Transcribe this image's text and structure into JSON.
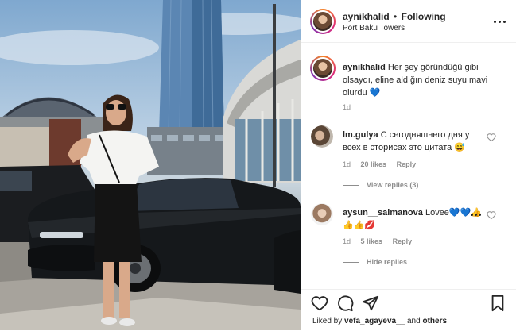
{
  "post": {
    "author": "aynikhalid",
    "separator": "•",
    "follow_status": "Following",
    "location": "Port Baku Towers"
  },
  "caption": {
    "author": "aynikhalid",
    "text": "Her şey göründüğü gibi olsaydı, eline aldığın deniz suyu mavi olurdu 💙",
    "time": "1d"
  },
  "comments": [
    {
      "user": "lm.gulya",
      "text": "С сегодняшнего дня у всех в сторисах это цитата 😅",
      "time": "1d",
      "likes": "20 likes",
      "reply": "Reply",
      "view_replies": "View replies (3)"
    },
    {
      "user": "aysun__salmanova",
      "text": "Lovee💙💙👍👍👍💋",
      "time": "1d",
      "likes": "5 likes",
      "reply": "Reply",
      "hide_replies": "Hide replies"
    }
  ],
  "footer": {
    "liked_by_prefix": "Liked by ",
    "liked_by_user": "vefa_agayeva__",
    "and": " and ",
    "others": "others"
  },
  "icons": {
    "more": "more-options-icon",
    "like": "heart-icon",
    "comment": "comment-icon",
    "share": "share-icon",
    "save": "bookmark-icon"
  },
  "colors": {
    "text": "#262626",
    "muted": "#8e8e8e",
    "heart_emoji": "#1e88e5"
  }
}
